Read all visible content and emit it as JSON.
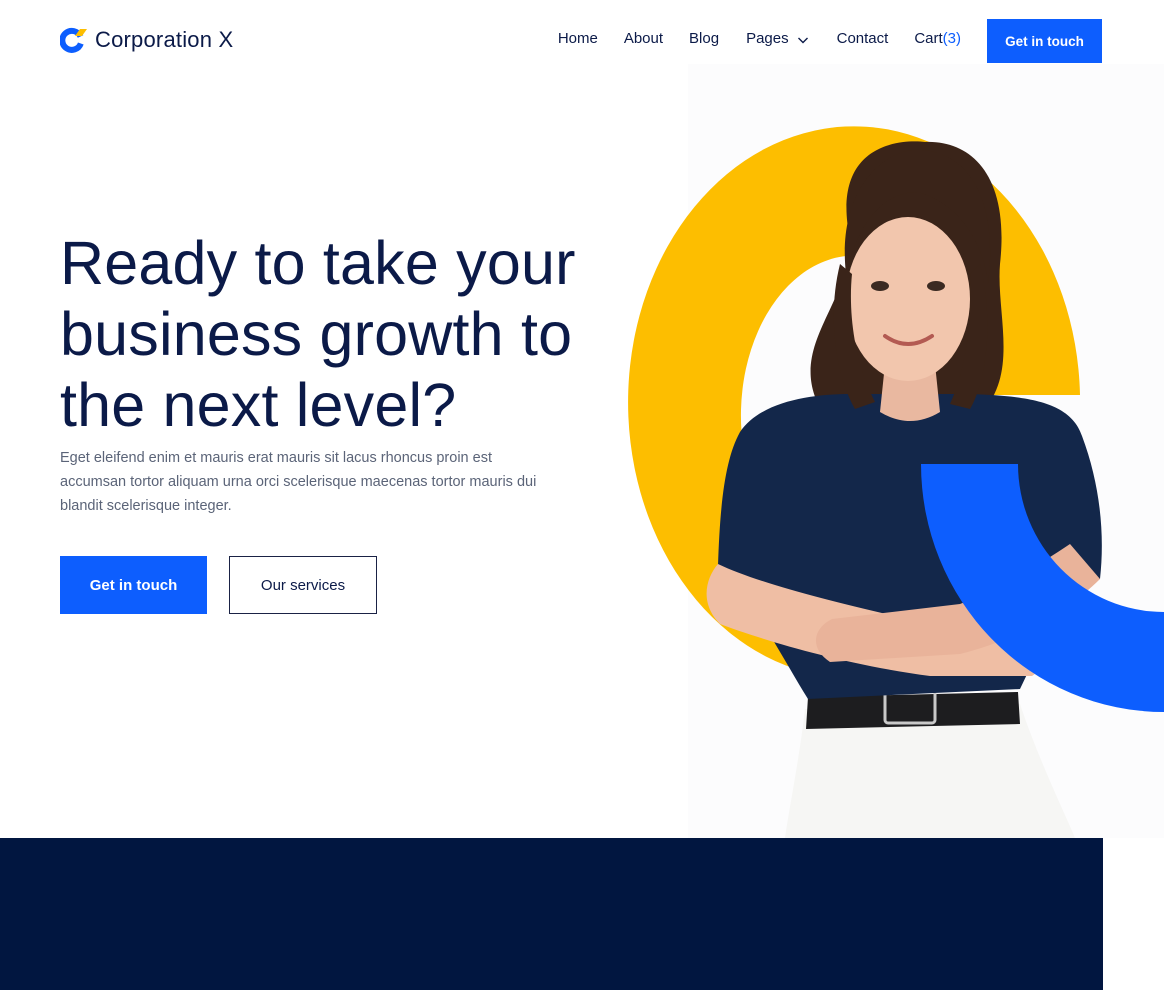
{
  "brand": {
    "name": "Corporation X",
    "accent_blue": "#0d5efe",
    "accent_yellow": "#fdbe00",
    "navy": "#0b1a48",
    "band_navy": "#011640"
  },
  "nav": {
    "items": [
      {
        "label": "Home"
      },
      {
        "label": "About"
      },
      {
        "label": "Blog"
      },
      {
        "label": "Pages",
        "icon": "chevron-down-icon"
      },
      {
        "label": "Contact"
      }
    ],
    "cart_label": "Cart",
    "cart_count": "(3)",
    "cta_label": "Get in touch"
  },
  "hero": {
    "title": "Ready to take your business growth to the next level?",
    "subtitle": "Eget eleifend enim et mauris erat mauris sit lacus rhoncus proin est accumsan tortor aliquam urna orci scelerisque maecenas tortor mauris dui blandit scelerisque integer.",
    "primary_button": "Get in touch",
    "secondary_button": "Our services",
    "image": "woman-portrait-image"
  }
}
